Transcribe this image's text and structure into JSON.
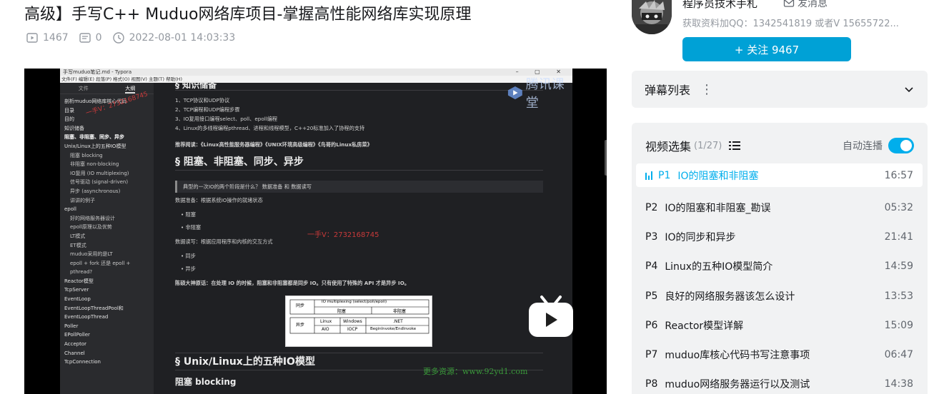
{
  "video": {
    "title": "高级】手写C++ Muduo网络库项目-掌握高性能网络库实现原理",
    "views": "1467",
    "danmaku_count": "0",
    "date": "2022-08-01 14:03:33"
  },
  "player": {
    "window_title": "手写muduo笔记.md - Typora",
    "menu": "文件(F)  编辑(E)  段落(P)  格式(O)  视图(V)  主题(T)  帮助(H)",
    "tab_files": "文件",
    "tab_outline": "大纲",
    "outline": [
      {
        "t": "剖析muduo网络库核心代码",
        "c": "l1"
      },
      {
        "t": "目录",
        "c": "l1"
      },
      {
        "t": "目的",
        "c": "l1"
      },
      {
        "t": "知识储备",
        "c": "l1"
      },
      {
        "t": "阻塞、非阻塞、同步、异步",
        "c": "l1 bold"
      },
      {
        "t": "Unix/Linux上的五种IO模型",
        "c": "l1"
      },
      {
        "t": "阻塞 blocking",
        "c": "l2"
      },
      {
        "t": "非阻塞 non-blocking",
        "c": "l2"
      },
      {
        "t": "IO复用 (IO multiplexing)",
        "c": "l2"
      },
      {
        "t": "信号驱动 (signal-driven)",
        "c": "l2"
      },
      {
        "t": "异步 (asynchronous)",
        "c": "l2"
      },
      {
        "t": "讲讲的例子",
        "c": "l2"
      },
      {
        "t": "epoll",
        "c": "l1"
      },
      {
        "t": "好的网络服务器设计",
        "c": "l2"
      },
      {
        "t": "epoll原理以及优势",
        "c": "l2"
      },
      {
        "t": "LT模式",
        "c": "l2"
      },
      {
        "t": "ET模式",
        "c": "l2"
      },
      {
        "t": "muduo采用的是LT",
        "c": "l2"
      },
      {
        "t": "epoll + fork 还是 epoll +",
        "c": "l2"
      },
      {
        "t": "pthread?",
        "c": "l2"
      },
      {
        "t": "Reactor模型",
        "c": "l1"
      },
      {
        "t": "TcpServer",
        "c": "l1"
      },
      {
        "t": "EventLoop",
        "c": "l1"
      },
      {
        "t": "EventLoopThreadPool和",
        "c": "l1"
      },
      {
        "t": "EventLoopThread",
        "c": "l1"
      },
      {
        "t": "Poller",
        "c": "l1"
      },
      {
        "t": "EPollPoller",
        "c": "l1"
      },
      {
        "t": "Acceptor",
        "c": "l1"
      },
      {
        "t": "Channel",
        "c": "l1"
      },
      {
        "t": "TcpConnection",
        "c": "l1"
      }
    ],
    "doc": {
      "h_top": "§ 知识储备",
      "li1": "1、TCP协议和UDP协议",
      "li2": "2、TCP编程和UDP编程步骤",
      "li3": "3、IO复用接口编程select、poll、epoll编程",
      "li4": "4、Linux的多线程编程pthread、进程和线程模型，C++20标准加入了协程的支持",
      "recommend": "推荐阅读：《Linux高性能服务器编程》《UNIX环境高级编程》《鸟哥的Linux私房菜》",
      "h_block": "§ 阻塞、非阻塞、同步、异步",
      "quote": "典型的一次IO的两个阶段是什么？ 数据准备 和 数据读写",
      "prep": "数据准备：根据系统IO操作的就绪状态",
      "b1": "• 阻塞",
      "b2": "• 非阻塞",
      "rw": "数据读写：根据应用程序和内核的交互方式",
      "b3": "• 同步",
      "b4": "• 异步",
      "quote2": "陈硕大神原话：在处理 IO 的时候，阻塞和非阻塞都是同步 IO。只有使用了特殊的 API 才是异步 IO。",
      "h_unix": "§ Unix/Linux上的五种IO模型",
      "h_blocking": "阻塞 blocking",
      "t_sync": "同步",
      "t_iomux": "IO multiplexing (select/poll/epoll)",
      "t_block": "阻塞",
      "t_nonblock": "非阻塞",
      "t_async": "异步",
      "t_linux": "Linux",
      "t_windows": "Windows",
      "t_net": ".NET",
      "t_aio": "AIO",
      "t_iocp": "IOCP",
      "t_begin": "BeginInvoke/EndInvoke"
    },
    "watermark_qq": "一手V：2732168745",
    "watermark_mid": "一手V：2732168745",
    "watermark_site": "更多资源：www.92yd1.com",
    "tencent_text": "腾讯课堂"
  },
  "uploader": {
    "name": "程序员技术手札",
    "message_label": "发消息",
    "description": "获取资料加QQ：1342541819 或者V 15655722...",
    "follow_label": "+ 关注 9467"
  },
  "danmaku_panel": {
    "title": "弹幕列表"
  },
  "episodes": {
    "title": "视频选集",
    "count": "(1/27)",
    "autoplay_label": "自动连播",
    "items": [
      {
        "num": "P1",
        "title": "IO的阻塞和非阻塞",
        "duration": "16:57"
      },
      {
        "num": "P2",
        "title": "IO的阻塞和非阻塞_勘误",
        "duration": "05:32"
      },
      {
        "num": "P3",
        "title": "IO的同步和异步",
        "duration": "21:41"
      },
      {
        "num": "P4",
        "title": "Linux的五种IO模型简介",
        "duration": "14:59"
      },
      {
        "num": "P5",
        "title": "良好的网络服务器该怎么设计",
        "duration": "13:53"
      },
      {
        "num": "P6",
        "title": "Reactor模型详解",
        "duration": "15:09"
      },
      {
        "num": "P7",
        "title": "muduo库核心代码书写注意事项",
        "duration": "06:47"
      },
      {
        "num": "P8",
        "title": "muduo网络服务器运行以及测试",
        "duration": "14:38"
      }
    ]
  },
  "colors": {
    "accent": "#00aeec",
    "follow": "#00a1d6",
    "panel": "#f1f2f3"
  }
}
